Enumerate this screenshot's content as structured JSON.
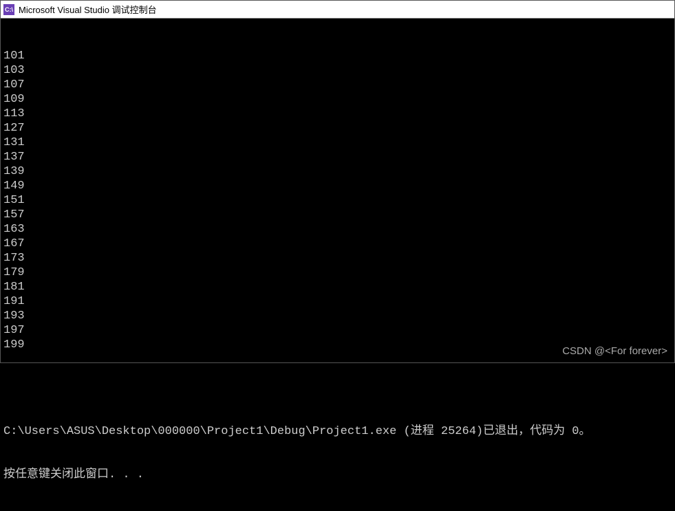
{
  "titlebar": {
    "icon_label": "C:\\",
    "title": "Microsoft Visual Studio 调试控制台"
  },
  "console": {
    "output_lines": [
      "101",
      "103",
      "107",
      "109",
      "113",
      "127",
      "131",
      "137",
      "139",
      "149",
      "151",
      "157",
      "163",
      "167",
      "173",
      "179",
      "181",
      "191",
      "193",
      "197",
      "199"
    ],
    "exit_line": "C:\\Users\\ASUS\\Desktop\\000000\\Project1\\Debug\\Project1.exe (进程 25264)已退出，代码为 0。",
    "prompt_line": "按任意键关闭此窗口. . ."
  },
  "watermark": "CSDN @<For forever>"
}
